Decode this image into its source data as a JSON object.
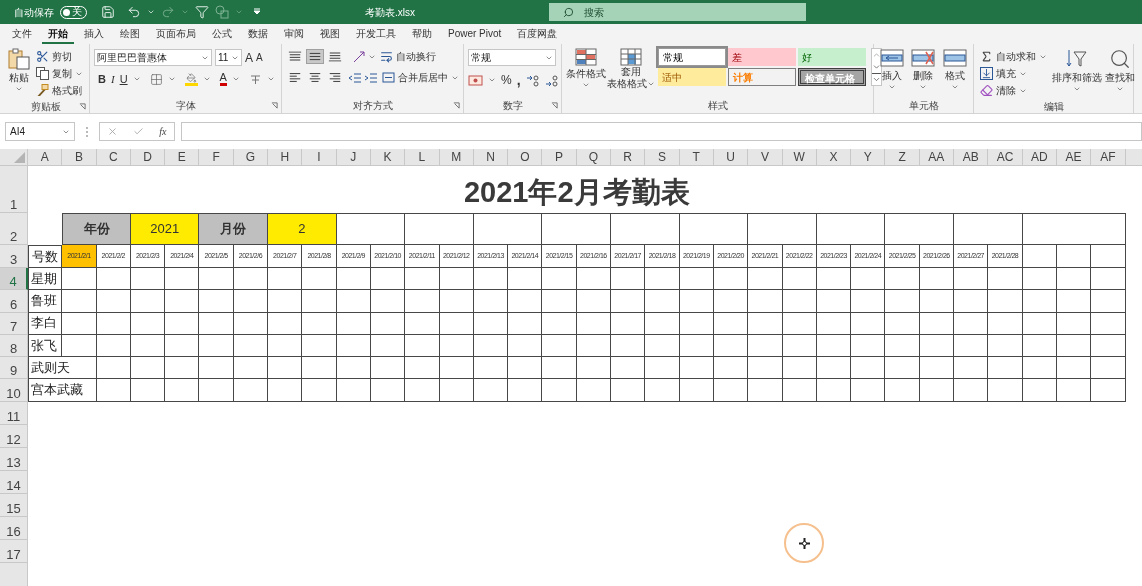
{
  "title_bar": {
    "autosave_label": "自动保存",
    "autosave_state": "关",
    "autosave_on": false,
    "filename": "考勤表.xlsx",
    "search_placeholder": "搜索"
  },
  "menu_tabs": [
    {
      "label": "文件",
      "selected": false
    },
    {
      "label": "开始",
      "selected": true
    },
    {
      "label": "插入",
      "selected": false
    },
    {
      "label": "绘图",
      "selected": false
    },
    {
      "label": "页面布局",
      "selected": false
    },
    {
      "label": "公式",
      "selected": false
    },
    {
      "label": "数据",
      "selected": false
    },
    {
      "label": "审阅",
      "selected": false
    },
    {
      "label": "视图",
      "selected": false
    },
    {
      "label": "开发工具",
      "selected": false
    },
    {
      "label": "帮助",
      "selected": false
    },
    {
      "label": "Power Pivot",
      "selected": false
    },
    {
      "label": "百度网盘",
      "selected": false
    }
  ],
  "ribbon": {
    "clipboard": {
      "label": "剪贴板",
      "paste": "粘贴",
      "cut": "剪切",
      "copy": "复制",
      "format_painter": "格式刷"
    },
    "font": {
      "label": "字体",
      "font_name": "阿里巴巴普惠体",
      "font_size": "11",
      "grow": "A",
      "shrink": "A",
      "bold": "B",
      "italic": "I",
      "underline": "U",
      "font_color": "A"
    },
    "alignment": {
      "label": "对齐方式",
      "vertical": [
        {
          "selected": false
        },
        {
          "selected": true
        },
        {
          "selected": false
        }
      ],
      "wrap_text": "自动换行",
      "merge_center": "合并后居中"
    },
    "number": {
      "label": "数字",
      "format": "常规",
      "percent": "%",
      "comma": ","
    },
    "styles": {
      "label": "样式",
      "conditional": "条件格式",
      "table_format_1": "套用",
      "table_format_2": "表格格式",
      "cell_styles": [
        {
          "text": "常规",
          "kind": "normal",
          "selected": true
        },
        {
          "text": "差",
          "kind": "bad",
          "selected": false
        },
        {
          "text": "好",
          "kind": "good",
          "selected": false
        },
        {
          "text": "适中",
          "kind": "neutral",
          "selected": false
        },
        {
          "text": "计算",
          "kind": "calculation",
          "selected": false
        },
        {
          "text": "检查单元格",
          "kind": "check",
          "selected": false
        }
      ]
    },
    "cells": {
      "label": "单元格",
      "insert": "插入",
      "delete": "删除",
      "format": "格式"
    },
    "editing": {
      "label": "编辑",
      "autosum": "自动求和",
      "fill": "填充",
      "clear": "清除",
      "sort_filter": "排序和筛选",
      "find": "查找和"
    }
  },
  "formula_bar": {
    "name_box": "AI4",
    "function_label": "fx"
  },
  "sheet": {
    "columns": [
      "A",
      "B",
      "C",
      "D",
      "E",
      "F",
      "G",
      "H",
      "I",
      "J",
      "K",
      "L",
      "M",
      "N",
      "O",
      "P",
      "Q",
      "R",
      "S",
      "T",
      "U",
      "V",
      "W",
      "X",
      "Y",
      "Z",
      "AA",
      "AB",
      "AC",
      "AD",
      "AE",
      "AF"
    ],
    "rows": [
      {
        "label": "1",
        "selected": false
      },
      {
        "label": "2",
        "selected": false
      },
      {
        "label": "3",
        "selected": false
      },
      {
        "label": "4",
        "selected": true
      },
      {
        "label": "6",
        "selected": false
      },
      {
        "label": "7",
        "selected": false
      },
      {
        "label": "8",
        "selected": false
      },
      {
        "label": "9",
        "selected": false
      },
      {
        "label": "10",
        "selected": false
      },
      {
        "label": "11",
        "selected": false
      },
      {
        "label": "12",
        "selected": false
      },
      {
        "label": "13",
        "selected": false
      },
      {
        "label": "14",
        "selected": false
      },
      {
        "label": "15",
        "selected": false
      },
      {
        "label": "16",
        "selected": false
      },
      {
        "label": "17",
        "selected": false
      }
    ],
    "title": "2021年2月考勤表",
    "info_cells": [
      {
        "text": "年份",
        "kind": "label"
      },
      {
        "text": "2021",
        "kind": "value"
      },
      {
        "text": "月份",
        "kind": "label"
      },
      {
        "text": "2",
        "kind": "value"
      }
    ],
    "day_label": "号数",
    "dates": [
      {
        "text": "2021/2/1",
        "selected": true
      },
      {
        "text": "2021/2/2",
        "selected": false
      },
      {
        "text": "2021/2/3",
        "selected": false
      },
      {
        "text": "2021/2/4",
        "selected": false
      },
      {
        "text": "2021/2/5",
        "selected": false
      },
      {
        "text": "2021/2/6",
        "selected": false
      },
      {
        "text": "2021/2/7",
        "selected": false
      },
      {
        "text": "2021/2/8",
        "selected": false
      },
      {
        "text": "2021/2/9",
        "selected": false
      },
      {
        "text": "2021/2/10",
        "selected": false
      },
      {
        "text": "2021/2/11",
        "selected": false
      },
      {
        "text": "2021/2/12",
        "selected": false
      },
      {
        "text": "2021/2/13",
        "selected": false
      },
      {
        "text": "2021/2/14",
        "selected": false
      },
      {
        "text": "2021/2/15",
        "selected": false
      },
      {
        "text": "2021/2/16",
        "selected": false
      },
      {
        "text": "2021/2/17",
        "selected": false
      },
      {
        "text": "2021/2/18",
        "selected": false
      },
      {
        "text": "2021/2/19",
        "selected": false
      },
      {
        "text": "2021/2/20",
        "selected": false
      },
      {
        "text": "2021/2/21",
        "selected": false
      },
      {
        "text": "2021/2/22",
        "selected": false
      },
      {
        "text": "2021/2/23",
        "selected": false
      },
      {
        "text": "2021/2/24",
        "selected": false
      },
      {
        "text": "2021/2/25",
        "selected": false
      },
      {
        "text": "2021/2/26",
        "selected": false
      },
      {
        "text": "2021/2/27",
        "selected": false
      },
      {
        "text": "2021/2/28",
        "selected": false
      }
    ],
    "names": [
      {
        "text": "星期",
        "wide": false
      },
      {
        "text": "鲁班",
        "wide": false
      },
      {
        "text": "李白",
        "wide": false
      },
      {
        "text": "张飞",
        "wide": false
      },
      {
        "text": "武则天",
        "wide": true
      },
      {
        "text": "宫本武藏",
        "wide": true
      }
    ]
  }
}
